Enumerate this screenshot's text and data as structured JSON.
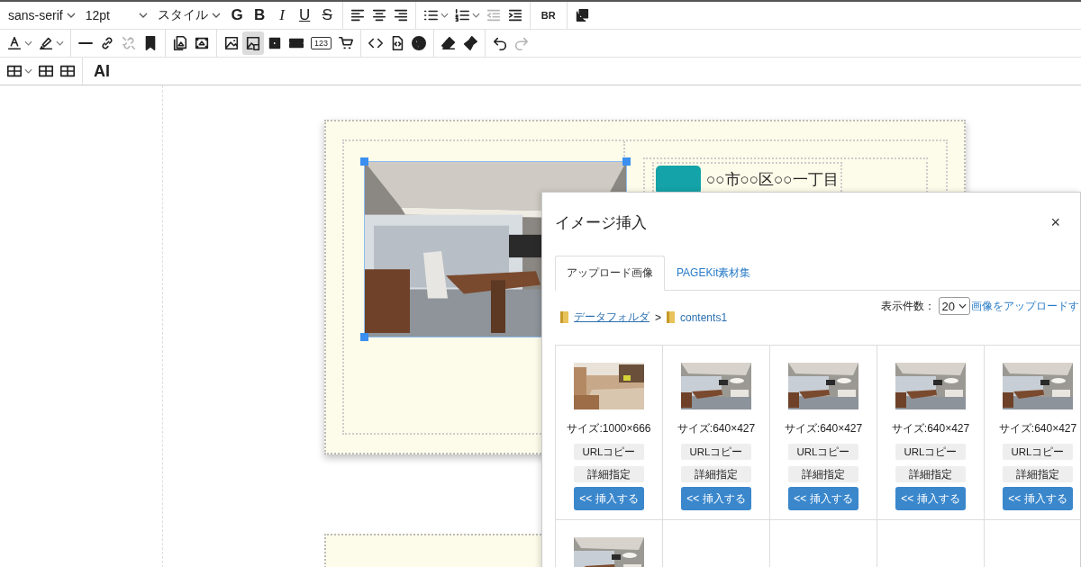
{
  "toolbar": {
    "top_row": [
      {
        "kind": "select",
        "label": "sans-serif"
      },
      {
        "kind": "select",
        "label": "12pt"
      },
      {
        "kind": "select",
        "label": "スタイル"
      },
      {
        "kind": "glyph",
        "label": "G"
      },
      {
        "kind": "glyph",
        "label": "B"
      },
      {
        "kind": "glyph",
        "label": "I"
      },
      {
        "kind": "glyph",
        "label": "U"
      },
      {
        "kind": "glyph",
        "label": "S"
      },
      {
        "kind": "sep"
      },
      {
        "kind": "icon",
        "disabled": false,
        "selected": false
      },
      {
        "kind": "icon",
        "disabled": false,
        "selected": false
      },
      {
        "kind": "icon",
        "disabled": false,
        "selected": false
      },
      {
        "kind": "sep"
      },
      {
        "kind": "split",
        "disabled": false,
        "selected": false
      },
      {
        "kind": "split",
        "disabled": false,
        "selected": false
      },
      {
        "kind": "icon",
        "disabled": true,
        "selected": false
      },
      {
        "kind": "icon",
        "disabled": false,
        "selected": false
      },
      {
        "kind": "sep"
      },
      {
        "kind": "glyph",
        "label": "BR"
      },
      {
        "kind": "sep"
      },
      {
        "kind": "icon",
        "disabled": false,
        "selected": false
      }
    ],
    "middle_row": [
      {
        "kind": "split",
        "disabled": false,
        "selected": false
      },
      {
        "kind": "split",
        "disabled": false,
        "selected": false
      },
      {
        "kind": "sep"
      },
      {
        "kind": "icon",
        "disabled": false,
        "selected": false
      },
      {
        "kind": "icon",
        "disabled": false,
        "selected": false
      },
      {
        "kind": "icon",
        "disabled": true,
        "selected": false
      },
      {
        "kind": "icon",
        "disabled": false,
        "selected": false
      },
      {
        "kind": "sep"
      },
      {
        "kind": "icon",
        "disabled": false,
        "selected": false
      },
      {
        "kind": "icon",
        "disabled": false,
        "selected": false
      },
      {
        "kind": "sep"
      },
      {
        "kind": "icon",
        "disabled": false,
        "selected": false
      },
      {
        "kind": "icon",
        "disabled": false,
        "selected": true
      },
      {
        "kind": "icon",
        "disabled": false,
        "selected": false
      },
      {
        "kind": "icon",
        "disabled": false,
        "selected": false
      },
      {
        "kind": "glyph",
        "label": "123"
      },
      {
        "kind": "icon",
        "disabled": false,
        "selected": false
      },
      {
        "kind": "sep"
      },
      {
        "kind": "icon",
        "disabled": false,
        "selected": false
      },
      {
        "kind": "icon",
        "disabled": false,
        "selected": false
      },
      {
        "kind": "icon",
        "disabled": false,
        "selected": false
      },
      {
        "kind": "sep"
      },
      {
        "kind": "icon",
        "disabled": false,
        "selected": false
      },
      {
        "kind": "icon",
        "disabled": false,
        "selected": false
      },
      {
        "kind": "sep"
      },
      {
        "kind": "icon",
        "disabled": false,
        "selected": false
      },
      {
        "kind": "icon",
        "disabled": true,
        "selected": false
      }
    ],
    "bottom_row": [
      {
        "kind": "split",
        "disabled": false,
        "selected": false
      },
      {
        "kind": "icon",
        "disabled": false,
        "selected": false
      },
      {
        "kind": "icon",
        "disabled": false,
        "selected": false
      },
      {
        "kind": "sep"
      },
      {
        "kind": "glyph",
        "label": "AI"
      }
    ]
  },
  "editor": {
    "address": "○○市○○区○○一丁目"
  },
  "dialog": {
    "title": "イメージ挿入",
    "close": "×",
    "tabs": [
      {
        "label": "アップロード画像",
        "selected": true
      },
      {
        "label": "PAGEKit素材集",
        "selected": false
      }
    ],
    "breadcrumb": {
      "root": "データフォルダ",
      "separator": ">",
      "current": "contents1"
    },
    "per_page_label": "表示件数：",
    "per_page": "20",
    "upload_link": "画像をアップロードす",
    "images": [
      {
        "kind": "full",
        "size": "サイズ:1000×666",
        "copy": "URLコピー",
        "detail": "詳細指定",
        "insert": "<< 挿入する"
      },
      {
        "kind": "full",
        "size": "サイズ:640×427",
        "copy": "URLコピー",
        "detail": "詳細指定",
        "insert": "<< 挿入する"
      },
      {
        "kind": "full",
        "size": "サイズ:640×427",
        "copy": "URLコピー",
        "detail": "詳細指定",
        "insert": "<< 挿入する"
      },
      {
        "kind": "full",
        "size": "サイズ:640×427",
        "copy": "URLコピー",
        "detail": "詳細指定",
        "insert": "<< 挿入する"
      },
      {
        "kind": "full",
        "size": "サイズ:640×427",
        "copy": "URLコピー",
        "detail": "詳細指定",
        "insert": "<< 挿入する"
      },
      {
        "kind": "partial"
      },
      {
        "kind": "empty"
      },
      {
        "kind": "empty"
      },
      {
        "kind": "empty"
      },
      {
        "kind": "empty"
      }
    ]
  }
}
